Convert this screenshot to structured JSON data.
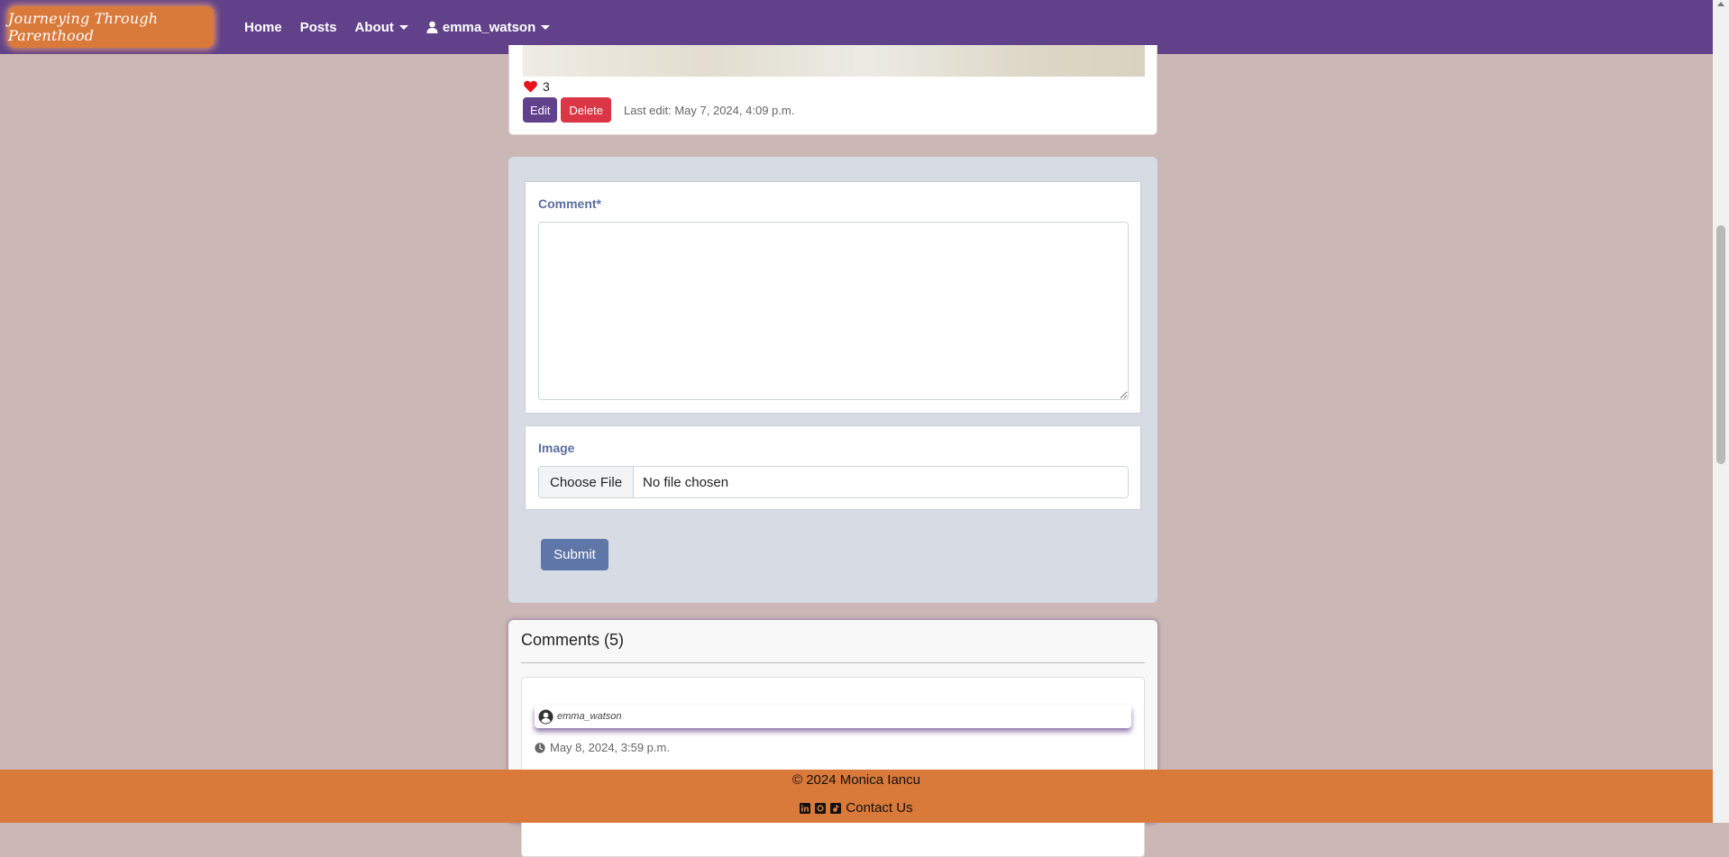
{
  "navbar": {
    "brand": "Journeying Through Parenthood",
    "links": {
      "home": "Home",
      "posts": "Posts",
      "about": "About",
      "user": "emma_watson"
    },
    "colors": {
      "background": "#61428a",
      "brand_bg": "#d9793a"
    }
  },
  "post": {
    "likes_count": "3",
    "edit_label": "Edit",
    "delete_label": "Delete",
    "last_edit": "Last edit: May 7, 2024, 4:09 p.m."
  },
  "comment_form": {
    "comment_label": "Comment*",
    "comment_value": "",
    "image_label": "Image",
    "file_button_label": "Choose File",
    "file_status": "No file chosen",
    "submit_label": "Submit"
  },
  "comments": {
    "title": "Comments (5)",
    "items": [
      {
        "author": "emma_watson",
        "date": "May 8, 2024, 3:59 p.m."
      }
    ]
  },
  "footer": {
    "copyright": "© 2024 Monica Iancu",
    "contact_label": "Contact Us",
    "icons": [
      "linkedin-icon",
      "github-icon",
      "music-icon"
    ]
  },
  "icons": {
    "user": "user-icon",
    "heart": "heart-icon",
    "clock": "clock-icon",
    "avatar": "user-circle-icon"
  }
}
